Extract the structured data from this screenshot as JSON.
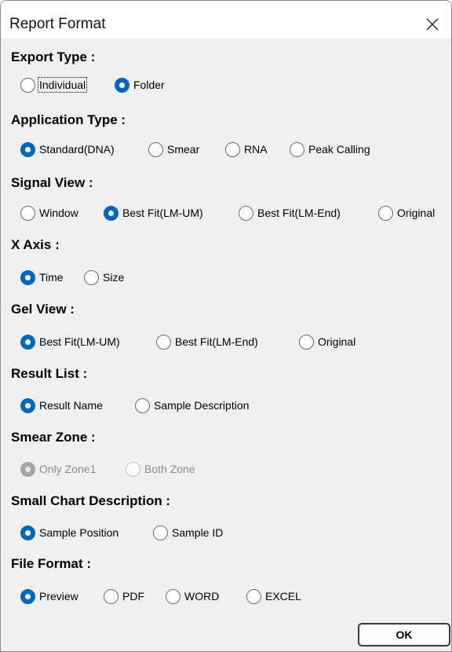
{
  "window": {
    "title": "Report Format",
    "close_icon": "close-icon"
  },
  "export_type": {
    "label": "Export Type :",
    "options": [
      "Individual",
      "Folder"
    ],
    "selected": "Folder"
  },
  "application_type": {
    "label": "Application Type :",
    "options": [
      "Standard(DNA)",
      "Smear",
      "RNA",
      "Peak Calling"
    ],
    "selected": "Standard(DNA)"
  },
  "signal_view": {
    "label": "Signal View :",
    "options": [
      "Window",
      "Best Fit(LM-UM)",
      "Best Fit(LM-End)",
      "Original"
    ],
    "selected": "Best Fit(LM-UM)"
  },
  "x_axis": {
    "label": "X Axis :",
    "options": [
      "Time",
      "Size"
    ],
    "selected": "Time"
  },
  "gel_view": {
    "label": "Gel View :",
    "options": [
      "Best Fit(LM-UM)",
      "Best Fit(LM-End)",
      "Original"
    ],
    "selected": "Best Fit(LM-UM)"
  },
  "result_list": {
    "label": "Result List :",
    "options": [
      "Result Name",
      "Sample Description"
    ],
    "selected": "Result Name"
  },
  "smear_zone": {
    "label": "Smear Zone :",
    "options": [
      "Only Zone1",
      "Both Zone"
    ],
    "selected": "Only Zone1",
    "disabled": true
  },
  "small_chart_description": {
    "label": "Small Chart Description :",
    "options": [
      "Sample Position",
      "Sample ID"
    ],
    "selected": "Sample Position"
  },
  "file_format": {
    "label": "File Format :",
    "options": [
      "Preview",
      "PDF",
      "WORD",
      "EXCEL"
    ],
    "selected": "Preview"
  },
  "footer": {
    "ok_label": "OK"
  },
  "colors": {
    "accent": "#0067c0",
    "disabled_check": "#a6a6a6",
    "background": "#f0f0f0"
  }
}
